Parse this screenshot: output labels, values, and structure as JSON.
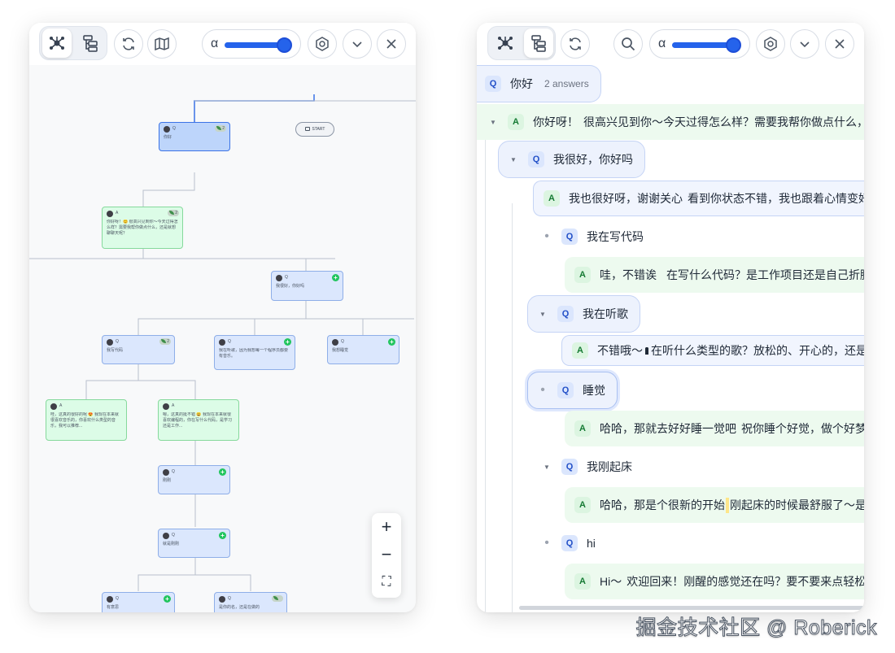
{
  "left_panel": {
    "toolbar": {
      "alpha_label": "α",
      "icons": [
        "graph-view-icon",
        "tree-view-icon",
        "refresh-icon",
        "map-icon",
        "settings-icon",
        "chevron-down-icon",
        "close-icon"
      ]
    },
    "start_label": "START",
    "nodes": [
      {
        "type": "Q",
        "text": "你好",
        "badge": "2"
      },
      {
        "type": "A",
        "text": "你好呀！😊 很高兴见到你～今天过得怎么样？需要我帮你做点什么，还是就想聊聊天呢？",
        "badge": "2"
      },
      {
        "type": "Q",
        "text": "我很好，你好吗"
      },
      {
        "type": "Q",
        "text": "我写代码",
        "badge": "2"
      },
      {
        "type": "Q",
        "text": "我在听歌，因为我想每一个程序员都要有音乐。"
      },
      {
        "type": "Q",
        "text": "我想睡觉"
      },
      {
        "type": "A",
        "text": "哇，这真的很好的呢 😍 我现在本来就很喜欢音乐的，你喜欢什么类型的音乐，我可以推荐..."
      },
      {
        "type": "A",
        "text": "嗯，这真的挺不错 😄 我现在本来就很喜欢编程的，你在写什么代码，是学习还是工作..."
      },
      {
        "type": "Q",
        "text": "刚刚"
      },
      {
        "type": "Q",
        "text": "就是刚刚"
      },
      {
        "type": "Q",
        "text": "有意思"
      },
      {
        "type": "Q",
        "text": "是你的名，还是在做的"
      }
    ],
    "zoom": {
      "in": "+",
      "out": "−",
      "fit": "⛶"
    }
  },
  "right_panel": {
    "toolbar": {
      "alpha_label": "α",
      "icons": [
        "graph-view-icon",
        "tree-view-icon",
        "refresh-icon",
        "search-icon",
        "settings-icon",
        "chevron-down-icon",
        "close-icon"
      ]
    },
    "rows": [
      {
        "kind": "Q",
        "text": "你好",
        "count": "2 answers"
      },
      {
        "kind": "A",
        "text": "你好呀！",
        "emoji": "😊",
        "rest": "很高兴见到你～今天过得怎么样？需要我帮你做点什么，还是就想聊聊天呢？"
      },
      {
        "kind": "Q",
        "text": "我很好，你好吗"
      },
      {
        "kind": "A",
        "text": "我也很好呀，谢谢关心",
        "emoji": "😄",
        "rest": "看到你状态不错，我也跟着心情变好了呢～"
      },
      {
        "kind": "Q",
        "text": "我在写代码"
      },
      {
        "kind": "A",
        "text": "哇，不错诶",
        "emoji": "💻✨",
        "rest": "在写什么代码？是工作项目还是自己折腾的小玩意儿？"
      },
      {
        "kind": "Q",
        "text": "我在听歌"
      },
      {
        "kind": "A",
        "text": "不错哦～",
        "emoji": "🎧",
        "rest": "在听什么类型的歌？放松的、开心的，还是有点小情绪的？"
      },
      {
        "kind": "Q",
        "text": "睡觉"
      },
      {
        "kind": "A",
        "text": "哈哈，那就去好好睡一觉吧",
        "emoji": "😴",
        "rest": "祝你睡个好觉，做个好梦～"
      },
      {
        "kind": "Q",
        "text": "我刚起床"
      },
      {
        "kind": "A",
        "text": "哈哈，那是个很新的开始",
        "emoji": "🌞",
        "rest": "刚起床的时候最舒服了～是打算先吃点东西还是再赖会儿床？"
      },
      {
        "kind": "Q",
        "text": "hi"
      },
      {
        "kind": "A",
        "text": "Hi～",
        "emoji": "👋",
        "rest": "欢迎回来！刚醒的感觉还在吗？要不要来点轻松的聊天？"
      }
    ]
  },
  "watermark": "掘金技术社区 @ Roberick",
  "colors": {
    "accent": "#2563eb",
    "question": "#dbe7fd",
    "answer": "#dcfce7",
    "selected": "#bdd5fb"
  }
}
